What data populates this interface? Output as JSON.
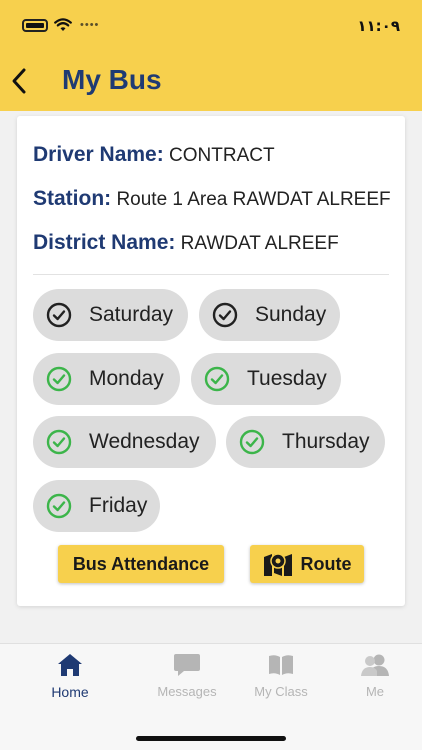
{
  "status_bar": {
    "time": "١١:٠٩",
    "signal_dots": "••••"
  },
  "header": {
    "title": "My Bus"
  },
  "bus_info": {
    "driver": {
      "label": "Driver Name:",
      "value": "CONTRACT"
    },
    "station": {
      "label": "Station:",
      "value": "Route 1 Area RAWDAT ALREEF"
    },
    "district": {
      "label": "District Name:",
      "value": "RAWDAT ALREEF"
    }
  },
  "days": [
    {
      "label": "Saturday",
      "state": "default"
    },
    {
      "label": "Sunday",
      "state": "default"
    },
    {
      "label": "Monday",
      "state": "checked"
    },
    {
      "label": "Tuesday",
      "state": "checked"
    },
    {
      "label": "Wednesday",
      "state": "checked"
    },
    {
      "label": "Thursday",
      "state": "checked"
    },
    {
      "label": "Friday",
      "state": "checked"
    }
  ],
  "actions": {
    "attendance": "Bus Attendance",
    "route": "Route"
  },
  "nav": [
    {
      "label": "Home",
      "icon": "home-icon",
      "active": true
    },
    {
      "label": "Messages",
      "icon": "messages-icon",
      "active": false
    },
    {
      "label": "My Class",
      "icon": "book-icon",
      "active": false
    },
    {
      "label": "Me",
      "icon": "users-icon",
      "active": false
    }
  ],
  "colors": {
    "header": "#f7d04d",
    "accent": "#1f3a73",
    "check_green": "#3cb54a",
    "check_dark": "#222222"
  }
}
